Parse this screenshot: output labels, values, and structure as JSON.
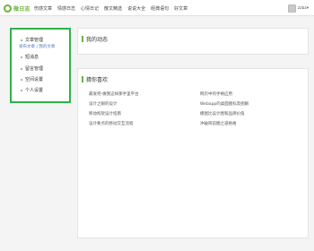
{
  "header": {
    "logo_text": "微日志",
    "nav": [
      "伤感文章",
      "情感日志",
      "心情日记",
      "散文精选",
      "说说大全",
      "经典语句",
      "好文章"
    ],
    "username": "zzbz▾"
  },
  "sidebar": {
    "items": [
      {
        "label": "文章管理",
        "icon": "dot-icon"
      },
      {
        "label": "短消息",
        "icon": "dot-icon"
      },
      {
        "label": "留言管理",
        "icon": "dot-icon"
      },
      {
        "label": "空间设置",
        "icon": "dot-icon"
      },
      {
        "label": "个人设置",
        "icon": "dot-icon"
      }
    ],
    "sub_links": "发布文章 | 我的文章"
  },
  "dynamics": {
    "title": "我的动态"
  },
  "guess": {
    "title": "猜你喜欢",
    "links": [
      "最发吧-做我这样那手里平台",
      "网页中的手柄应用",
      "设计之眼的设计",
      "Webapp的桌面图标及图解",
      "移动构架设计指南",
      "模图比设计图和品牌价值",
      "设计要点的移动交互流程",
      "冲破目前圈之道格格"
    ]
  },
  "colors": {
    "accent": "#6cb33e",
    "sidebar_border": "#2db34a"
  }
}
